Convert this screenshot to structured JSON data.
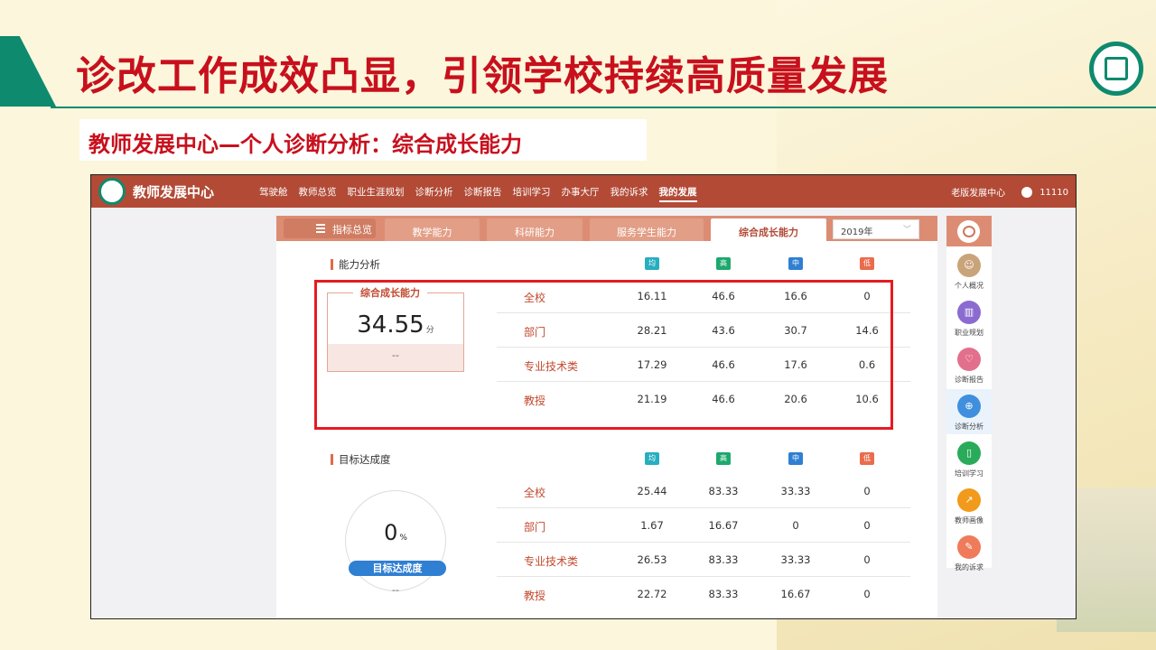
{
  "slide": {
    "title": "诊改工作成效凸显，引领学校持续高质量发展",
    "subtitle": "教师发展中心—个人诊断分析：综合成长能力"
  },
  "navbar": {
    "brand": "教师发展中心",
    "menu": [
      "驾驶舱",
      "教师总览",
      "职业生涯规划",
      "诊断分析",
      "诊断报告",
      "培训学习",
      "办事大厅",
      "我的诉求",
      "我的发展"
    ],
    "active_index": 8,
    "old_version": "老版发展中心",
    "user_id": "11110"
  },
  "tabs": {
    "overview": "指标总览",
    "items": [
      "教学能力",
      "科研能力",
      "服务学生能力",
      "综合成长能力"
    ],
    "active": "综合成长能力",
    "year": "2019年"
  },
  "levels": [
    "均",
    "高",
    "中",
    "低"
  ],
  "ability": {
    "heading": "能力分析",
    "card_caption": "综合成长能力",
    "score": "34.55",
    "score_unit": "分",
    "card_foot": "--",
    "rows": [
      {
        "label": "全校",
        "values": [
          "16.11",
          "46.6",
          "16.6",
          "0"
        ]
      },
      {
        "label": "部门",
        "values": [
          "28.21",
          "43.6",
          "30.7",
          "14.6"
        ]
      },
      {
        "label": "专业技术类",
        "values": [
          "17.29",
          "46.6",
          "17.6",
          "0.6"
        ]
      },
      {
        "label": "教授",
        "values": [
          "21.19",
          "46.6",
          "20.6",
          "10.6"
        ]
      }
    ]
  },
  "target": {
    "heading": "目标达成度",
    "percent": "0",
    "percent_unit": "%",
    "badge": "目标达成度",
    "foot": "--",
    "rows": [
      {
        "label": "全校",
        "values": [
          "25.44",
          "83.33",
          "33.33",
          "0"
        ]
      },
      {
        "label": "部门",
        "values": [
          "1.67",
          "16.67",
          "0",
          "0"
        ]
      },
      {
        "label": "专业技术类",
        "values": [
          "26.53",
          "83.33",
          "33.33",
          "0"
        ]
      },
      {
        "label": "教授",
        "values": [
          "22.72",
          "83.33",
          "16.67",
          "0"
        ]
      }
    ]
  },
  "sidebar": {
    "items": [
      {
        "label": "个人概况",
        "icon": "person-icon",
        "color": "#c9a47a"
      },
      {
        "label": "职业规划",
        "icon": "book-icon",
        "color": "#8b6bd0"
      },
      {
        "label": "诊断报告",
        "icon": "heart-icon",
        "color": "#e2708c"
      },
      {
        "label": "诊断分析",
        "icon": "globe-icon",
        "color": "#3f8fde"
      },
      {
        "label": "培训学习",
        "icon": "open-book-icon",
        "color": "#2aab5a"
      },
      {
        "label": "教师画像",
        "icon": "trend-icon",
        "color": "#f29a1c"
      },
      {
        "label": "我的诉求",
        "icon": "edit-icon",
        "color": "#ef7b5a"
      }
    ],
    "active_index": 3
  }
}
